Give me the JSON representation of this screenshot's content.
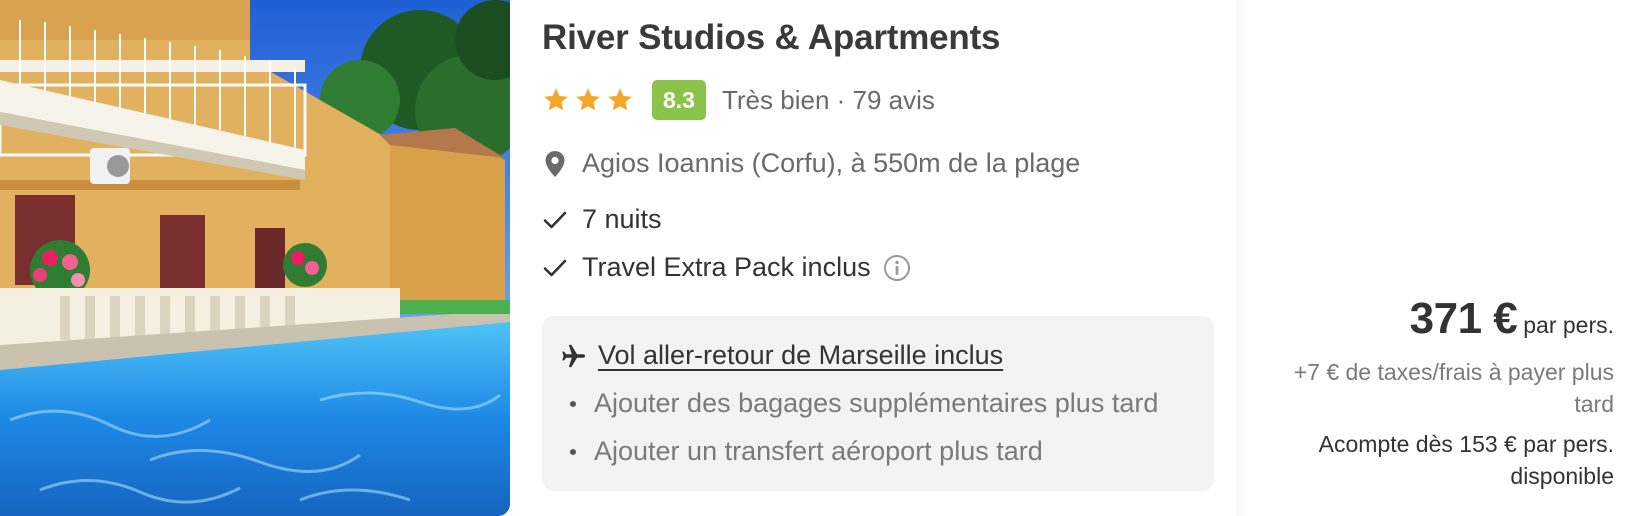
{
  "hotel": {
    "image_alt": "",
    "name": "River Studios & Apartments",
    "stars": 3,
    "star_color": "#f5a623",
    "score": "8.3",
    "score_color": "#8bc34a",
    "rating_text": "Très bien · 79 avis",
    "location": "Agios Ioannis (Corfu), à 550m de la plage",
    "features": [
      "7 nuits",
      "Travel Extra Pack inclus"
    ]
  },
  "icons": {
    "location": "map-pin-icon",
    "check": "check-icon",
    "info": "info-circle-icon",
    "flight": "airplane-icon"
  },
  "flight": {
    "title": "Vol aller-retour de Marseille inclus",
    "items": [
      "Ajouter des bagages supplémentaires plus tard",
      "Ajouter un transfert aéroport plus tard"
    ]
  },
  "price": {
    "amount": "371 €",
    "per": "par pers.",
    "taxes": "+7 € de taxes/frais à payer plus tard",
    "deposit": "Acompte dès 153 € par pers. disponible"
  }
}
